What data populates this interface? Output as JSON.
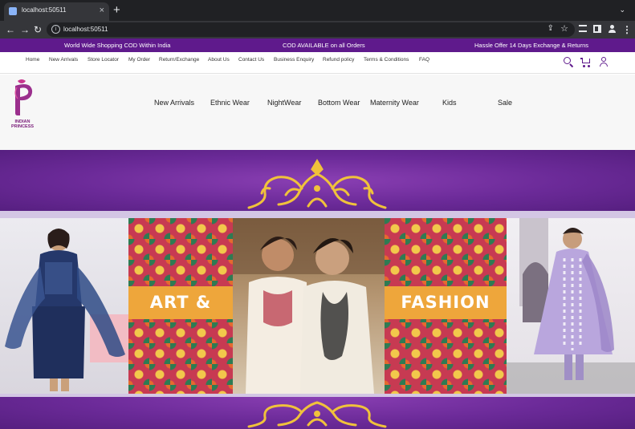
{
  "browser": {
    "tab_title": "localhost:50511",
    "url": "localhost:50511",
    "close_glyph": "×",
    "new_tab_glyph": "+",
    "tab_menu_glyph": "⌄",
    "back_glyph": "←",
    "forward_glyph": "→",
    "reload_glyph": "↻",
    "more_glyph": "⋮",
    "share_glyph": "⇪",
    "star_glyph": "☆",
    "info_glyph": "i"
  },
  "announcement": {
    "left": "World Wide Shopping COD Within India",
    "center": "COD AVAILABLE on all Orders",
    "right": "Hassle Offer 14 Days Exchange & Returns"
  },
  "top_nav": [
    "Home",
    "New Arrivals",
    "Store Locator",
    "My Order",
    "Return/Exchange",
    "About Us",
    "Contact Us",
    "Business Enquiry",
    "Refund policy",
    "Terms & Conditions",
    "FAQ"
  ],
  "brand": {
    "logo_text": "INDIAN PRINCESS",
    "accent_color": "#5f1a8c"
  },
  "categories": [
    "New Arrivals",
    "Ethnic Wear",
    "NightWear",
    "Bottom Wear",
    "Maternity Wear",
    "Kids",
    "Sale"
  ],
  "hero": {
    "label_left": "ART &",
    "label_right": "FASHION"
  },
  "icons": [
    "search-icon",
    "cart-icon",
    "user-icon"
  ]
}
